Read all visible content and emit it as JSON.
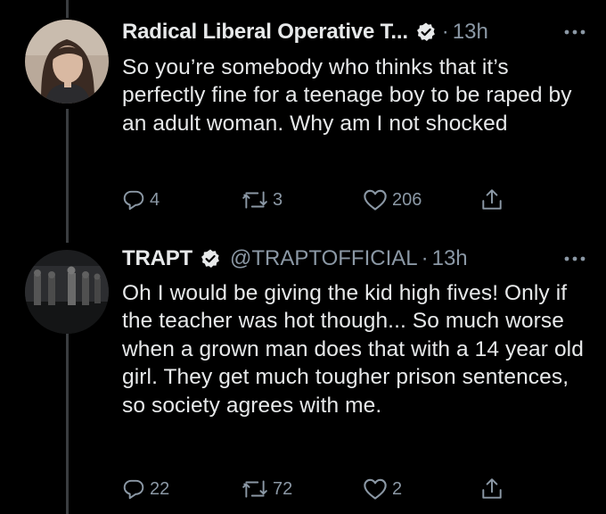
{
  "tweets": [
    {
      "display_name": "Radical Liberal Operative T...",
      "verified": true,
      "handle": "",
      "dot": "·",
      "time": "13h",
      "text": "So you’re somebody who thinks that it’s perfectly fine for a teenage boy to be raped by an adult woman. Why am I not shocked",
      "replies": "4",
      "retweets": "3",
      "likes": "206",
      "avatar_icon": "user-avatar-woman"
    },
    {
      "display_name": "TRAPT",
      "verified": true,
      "handle": "@TRAPTOFFICIAL",
      "dot": "·",
      "time": "13h",
      "text": "Oh I would be giving the kid high fives! Only if the teacher was hot though... So much worse when a grown man does that with a 14 year old girl. They get much tougher prison sentences, so society agrees with me.",
      "replies": "22",
      "retweets": "72",
      "likes": "2",
      "avatar_icon": "band-photo-avatar"
    }
  ],
  "icons": {
    "verified": "verified-badge-icon",
    "more": "more-options-icon",
    "reply": "reply-icon",
    "retweet": "retweet-icon",
    "like": "like-icon",
    "share": "share-icon"
  },
  "colors": {
    "background": "#000000",
    "primary_text": "#e7e9ea",
    "secondary_text": "#8b98a5",
    "thread_line": "#3a3d40"
  }
}
